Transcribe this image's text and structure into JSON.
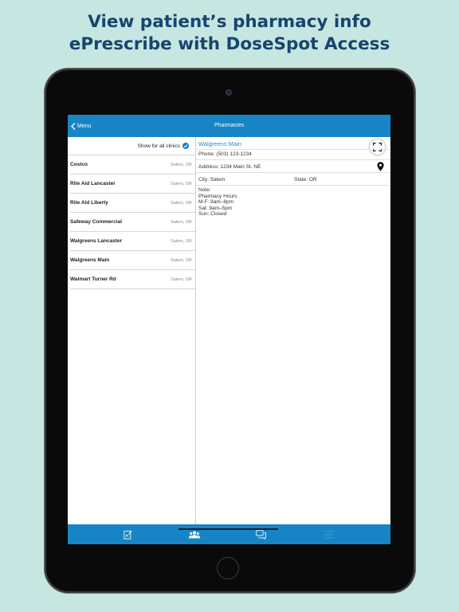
{
  "headline": {
    "line1": "View patient’s pharmacy info",
    "line2": "ePrescribe with DoseSpot Access"
  },
  "navbar": {
    "back_label": "Menu",
    "title": "Pharmacies"
  },
  "left_pane": {
    "show_all_label": "Show for all clinics",
    "show_all_checked": true,
    "pharmacies": [
      {
        "name": "Costco",
        "location": "Salem, OR"
      },
      {
        "name": "Rite Aid Lancaster",
        "location": "Salem, OR"
      },
      {
        "name": "Rite Aid Liberty",
        "location": "Salem, OR"
      },
      {
        "name": "Safeway Commercial",
        "location": "Salem, OR"
      },
      {
        "name": "Walgreens Lancaster",
        "location": "Salem, OR"
      },
      {
        "name": "Walgreens Main",
        "location": "Salem, OR"
      },
      {
        "name": "Walmart Turner Rd",
        "location": "Salem, OR"
      }
    ]
  },
  "detail": {
    "name": "Walgreens Main",
    "phone": "Phone: (503) 123-1234",
    "address": "Address: 1234 Main St. NE",
    "city": "City: Salem",
    "state": "State: OR",
    "note_lines": [
      "Note:",
      "Pharmacy Hours",
      "M-F: 8am–8pm",
      "Sat: 9am–5pm",
      "Sun: Closed"
    ]
  },
  "tabbar": {
    "tabs": [
      {
        "icon": "clipboard-icon"
      },
      {
        "icon": "people-icon",
        "active": true
      },
      {
        "icon": "chat-icon"
      },
      {
        "icon": "menu-icon"
      }
    ]
  },
  "colors": {
    "background": "#c6e6e1",
    "headline": "#16456e",
    "accent": "#1785c5",
    "link": "#1d8fd4"
  }
}
